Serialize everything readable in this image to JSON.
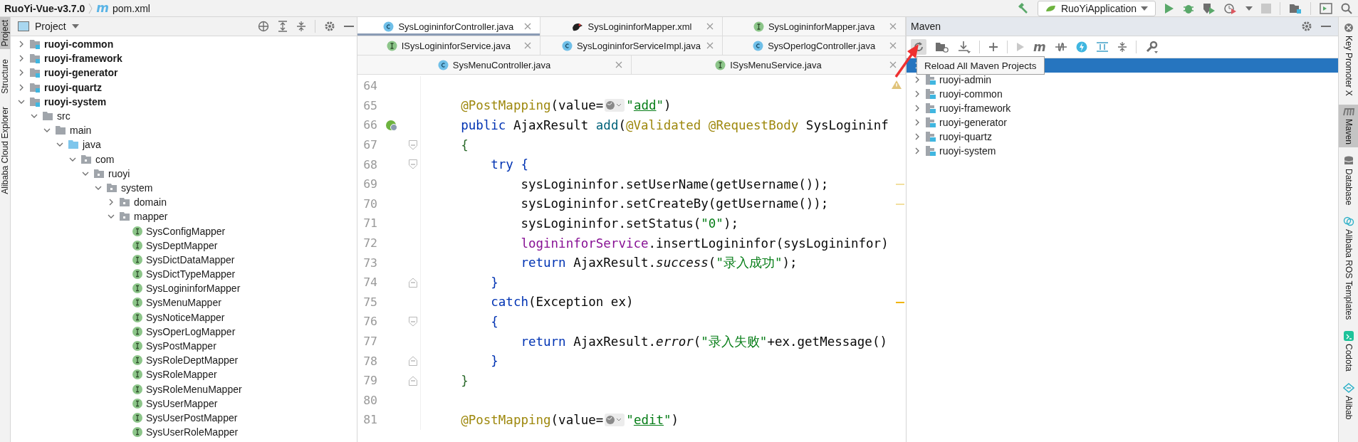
{
  "nav_bar": {
    "breadcrumb": [
      {
        "label": "RuoYi-Vue-v3.7.0",
        "kind": "project"
      },
      {
        "label": "pom.xml",
        "kind": "maven-file",
        "glyph": "m"
      }
    ],
    "run_config": "RuoYiApplication"
  },
  "left_strip": [
    {
      "label": "Project",
      "selected": true
    },
    {
      "label": "Structure",
      "selected": false
    },
    {
      "label": "Alibaba Cloud Explorer",
      "selected": false
    }
  ],
  "project_panel": {
    "title": "Project",
    "tree": [
      {
        "label": "ruoyi-common",
        "kind": "module",
        "expanded": false
      },
      {
        "label": "ruoyi-framework",
        "kind": "module",
        "expanded": false
      },
      {
        "label": "ruoyi-generator",
        "kind": "module",
        "expanded": false
      },
      {
        "label": "ruoyi-quartz",
        "kind": "module",
        "expanded": false
      },
      {
        "label": "ruoyi-system",
        "kind": "module",
        "expanded": true,
        "children": [
          {
            "label": "src",
            "kind": "folder",
            "expanded": true,
            "children": [
              {
                "label": "main",
                "kind": "folder",
                "expanded": true,
                "children": [
                  {
                    "label": "java",
                    "kind": "source-root",
                    "expanded": true,
                    "children": [
                      {
                        "label": "com",
                        "kind": "package",
                        "expanded": true,
                        "children": [
                          {
                            "label": "ruoyi",
                            "kind": "package",
                            "expanded": true,
                            "children": [
                              {
                                "label": "system",
                                "kind": "package",
                                "expanded": true,
                                "children": [
                                  {
                                    "label": "domain",
                                    "kind": "package",
                                    "expanded": false
                                  },
                                  {
                                    "label": "mapper",
                                    "kind": "package",
                                    "expanded": true,
                                    "children": [
                                      {
                                        "label": "SysConfigMapper",
                                        "kind": "interface"
                                      },
                                      {
                                        "label": "SysDeptMapper",
                                        "kind": "interface"
                                      },
                                      {
                                        "label": "SysDictDataMapper",
                                        "kind": "interface"
                                      },
                                      {
                                        "label": "SysDictTypeMapper",
                                        "kind": "interface"
                                      },
                                      {
                                        "label": "SysLogininforMapper",
                                        "kind": "interface"
                                      },
                                      {
                                        "label": "SysMenuMapper",
                                        "kind": "interface"
                                      },
                                      {
                                        "label": "SysNoticeMapper",
                                        "kind": "interface"
                                      },
                                      {
                                        "label": "SysOperLogMapper",
                                        "kind": "interface"
                                      },
                                      {
                                        "label": "SysPostMapper",
                                        "kind": "interface"
                                      },
                                      {
                                        "label": "SysRoleDeptMapper",
                                        "kind": "interface"
                                      },
                                      {
                                        "label": "SysRoleMapper",
                                        "kind": "interface"
                                      },
                                      {
                                        "label": "SysRoleMenuMapper",
                                        "kind": "interface"
                                      },
                                      {
                                        "label": "SysUserMapper",
                                        "kind": "interface"
                                      },
                                      {
                                        "label": "SysUserPostMapper",
                                        "kind": "interface"
                                      },
                                      {
                                        "label": "SysUserRoleMapper",
                                        "kind": "interface"
                                      }
                                    ]
                                  }
                                ]
                              }
                            ]
                          }
                        ]
                      }
                    ]
                  }
                ]
              }
            ]
          }
        ]
      }
    ]
  },
  "editor": {
    "tab_rows": [
      {
        "tabs": [
          {
            "label": "SysLogininforController.java",
            "kind": "class",
            "selected": true
          },
          {
            "label": "SysLogininforMapper.xml",
            "kind": "xml",
            "selected": false
          },
          {
            "label": "SysLogininforMapper.java",
            "kind": "interface",
            "selected": false
          }
        ]
      },
      {
        "tabs": [
          {
            "label": "ISysLogininforService.java",
            "kind": "interface",
            "selected": false
          },
          {
            "label": "SysLogininforServiceImpl.java",
            "kind": "class",
            "selected": false
          },
          {
            "label": "SysOperlogController.java",
            "kind": "class",
            "selected": false
          }
        ]
      },
      {
        "tabs": [
          {
            "label": "SysMenuController.java",
            "kind": "class",
            "selected": false
          },
          {
            "label": "ISysMenuService.java",
            "kind": "interface",
            "selected": false
          }
        ]
      }
    ],
    "inspection_warning": true,
    "lines": [
      {
        "number": "64"
      },
      {
        "number": "65",
        "tokens": [
          {
            "text": "    @PostMapping",
            "kind": "annotation"
          },
          {
            "text": "(value=",
            "kind": "plain"
          },
          {
            "kind": "inlay"
          },
          {
            "text": "\"",
            "kind": "string"
          },
          {
            "text": "add",
            "kind": "string-link"
          },
          {
            "text": "\"",
            "kind": "string"
          },
          {
            "text": ")",
            "kind": "plain"
          }
        ]
      },
      {
        "number": "66",
        "spring_bean": true,
        "tokens": [
          {
            "text": "    public ",
            "kind": "keyword"
          },
          {
            "text": "AjaxResult ",
            "kind": "plain"
          },
          {
            "text": "add",
            "kind": "method-decl"
          },
          {
            "text": "(",
            "kind": "plain"
          },
          {
            "text": "@Validated @RequestBody ",
            "kind": "annotation"
          },
          {
            "text": "SysLogininf",
            "kind": "plain"
          }
        ]
      },
      {
        "number": "67",
        "fold_start": true,
        "tokens": [
          {
            "text": "    {",
            "kind": "brace-outer"
          }
        ]
      },
      {
        "number": "68",
        "fold_start": true,
        "tokens": [
          {
            "text": "        try ",
            "kind": "keyword"
          },
          {
            "text": "{",
            "kind": "brace-inner"
          }
        ]
      },
      {
        "number": "69",
        "inspection_mark": true,
        "inspection_strong": false,
        "tokens": [
          {
            "text": "            sysLogininfor.setUserName(getUsername());",
            "kind": "plain"
          }
        ]
      },
      {
        "number": "70",
        "inspection_mark": true,
        "inspection_strong": false,
        "tokens": [
          {
            "text": "            sysLogininfor.setCreateBy(getUsername());",
            "kind": "plain"
          }
        ]
      },
      {
        "number": "71",
        "tokens": [
          {
            "text": "            sysLogininfor.setStatus(",
            "kind": "plain"
          },
          {
            "text": "\"0\"",
            "kind": "string"
          },
          {
            "text": ");",
            "kind": "plain"
          }
        ]
      },
      {
        "number": "72",
        "tokens": [
          {
            "text": "            logininforService",
            "kind": "field"
          },
          {
            "text": ".insertLogininfor(sysLogininfor)",
            "kind": "plain"
          }
        ]
      },
      {
        "number": "73",
        "tokens": [
          {
            "text": "            return ",
            "kind": "keyword"
          },
          {
            "text": "AjaxResult.",
            "kind": "plain"
          },
          {
            "text": "success",
            "kind": "static"
          },
          {
            "text": "(",
            "kind": "plain"
          },
          {
            "text": "\"录入成功\"",
            "kind": "string"
          },
          {
            "text": ");",
            "kind": "plain"
          }
        ]
      },
      {
        "number": "74",
        "fold_end": true,
        "tokens": [
          {
            "text": "        }",
            "kind": "brace-inner"
          }
        ]
      },
      {
        "number": "75",
        "inspection_mark": true,
        "inspection_strong": true,
        "tokens": [
          {
            "text": "        catch",
            "kind": "keyword"
          },
          {
            "text": "(Exception ex)",
            "kind": "plain"
          }
        ]
      },
      {
        "number": "76",
        "fold_start": true,
        "tokens": [
          {
            "text": "        {",
            "kind": "brace-inner"
          }
        ]
      },
      {
        "number": "77",
        "tokens": [
          {
            "text": "            return ",
            "kind": "keyword"
          },
          {
            "text": "AjaxResult.",
            "kind": "plain"
          },
          {
            "text": "error",
            "kind": "static"
          },
          {
            "text": "(",
            "kind": "plain"
          },
          {
            "text": "\"录入失败\"",
            "kind": "string"
          },
          {
            "text": "+ex.getMessage()",
            "kind": "plain"
          }
        ]
      },
      {
        "number": "78",
        "fold_end": true,
        "tokens": [
          {
            "text": "        }",
            "kind": "brace-inner"
          }
        ]
      },
      {
        "number": "79",
        "fold_end": true,
        "tokens": [
          {
            "text": "    }",
            "kind": "brace-outer"
          }
        ]
      },
      {
        "number": "80"
      },
      {
        "number": "81",
        "tokens": [
          {
            "text": "    @PostMapping",
            "kind": "annotation"
          },
          {
            "text": "(value=",
            "kind": "plain"
          },
          {
            "kind": "inlay"
          },
          {
            "text": "\"",
            "kind": "string"
          },
          {
            "text": "edit",
            "kind": "string-link"
          },
          {
            "text": "\"",
            "kind": "string"
          },
          {
            "text": ")",
            "kind": "plain"
          }
        ]
      }
    ]
  },
  "maven_panel": {
    "title": "Maven",
    "toolbar_glyph": "m",
    "tooltip": "Reload All Maven Projects",
    "projects": [
      {
        "selected": true,
        "expanded": false
      },
      {
        "label": "ruoyi-admin",
        "selected": false,
        "expanded": false
      },
      {
        "label": "ruoyi-common",
        "selected": false,
        "expanded": false
      },
      {
        "label": "ruoyi-framework",
        "selected": false,
        "expanded": false
      },
      {
        "label": "ruoyi-generator",
        "selected": false,
        "expanded": false
      },
      {
        "label": "ruoyi-quartz",
        "selected": false,
        "expanded": false
      },
      {
        "label": "ruoyi-system",
        "selected": false,
        "expanded": false
      }
    ]
  },
  "right_strip": [
    {
      "label": "Key Promoter X",
      "kind": "key-promoter",
      "selected": false
    },
    {
      "label": "Maven",
      "kind": "maven",
      "selected": true
    },
    {
      "label": "Database",
      "kind": "database",
      "selected": false
    },
    {
      "label": "Alibaba ROS Templates",
      "kind": "ros",
      "selected": false
    },
    {
      "label": "Codota",
      "kind": "codota",
      "selected": false
    },
    {
      "label": "Alibab",
      "kind": "alibaba",
      "selected": false
    }
  ]
}
